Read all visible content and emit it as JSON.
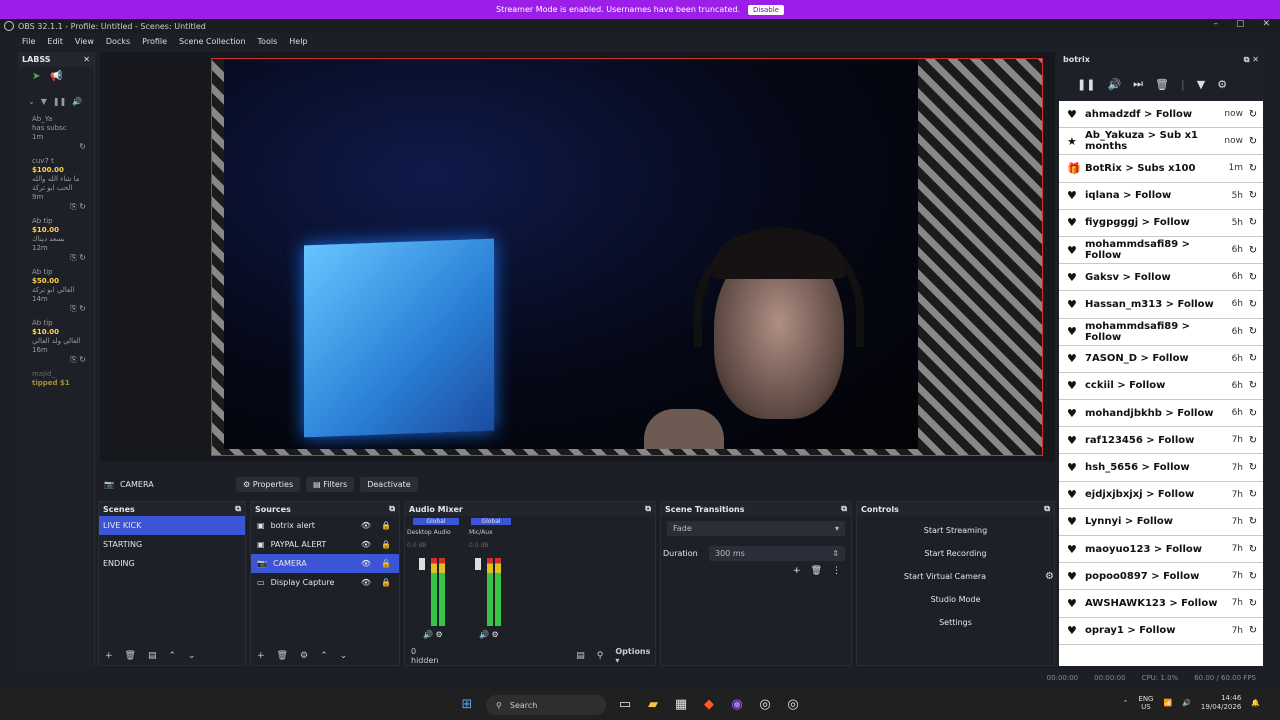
{
  "streamer_bar": {
    "message": "Streamer Mode is enabled. Usernames have been truncated.",
    "button": "Disable"
  },
  "window": {
    "title": "OBS 32.1.1 - Profile: Untitled - Scenes: Untitled"
  },
  "menu": [
    "File",
    "Edit",
    "View",
    "Docks",
    "Profile",
    "Scene Collection",
    "Tools",
    "Help"
  ],
  "labss": {
    "title": "LABSS",
    "items": [
      {
        "name": "Ab_Ya",
        "text": "has subsc",
        "time": "1m"
      },
      {
        "name": "cuv7 t",
        "amount": "$100.00",
        "text": "ما شاء الله والله الحب ابو تركة",
        "time": "9m"
      },
      {
        "name": "Ab tip",
        "amount": "$10.00",
        "text": "يسعد ديناك",
        "time": "12m"
      },
      {
        "name": "Ab tip",
        "amount": "$50.00",
        "text": "الغالي ابو تركة",
        "time": "14m"
      },
      {
        "name": "Ab tip",
        "amount": "$10.00",
        "text": "الغالي ولد الغالي",
        "time": "16m"
      },
      {
        "name": "majid_",
        "amount": "tipped $1",
        "text": ""
      }
    ]
  },
  "toolbar": {
    "scene_name": "CAMERA",
    "properties": "Properties",
    "filters": "Filters",
    "deactivate": "Deactivate"
  },
  "scenes": {
    "title": "Scenes",
    "items": [
      "LIVE KICK",
      "STARTING",
      "ENDING"
    ]
  },
  "sources": {
    "title": "Sources",
    "items": [
      "botrix alert",
      "PAYPAL ALERT",
      "CAMERA",
      "Display Capture"
    ]
  },
  "audio": {
    "title": "Audio Mixer",
    "ch1": {
      "badge": "Global",
      "name": "Desktop Audio",
      "db": "0.0 dB"
    },
    "ch2": {
      "badge": "Global",
      "name": "Mic/Aux",
      "db": "0.0 dB"
    },
    "hidden": "0 hidden",
    "options": "Options"
  },
  "transitions": {
    "title": "Scene Transitions",
    "type": "Fade",
    "duration_label": "Duration",
    "duration": "300 ms"
  },
  "controls": {
    "title": "Controls",
    "buttons": [
      "Start Streaming",
      "Start Recording",
      "Start Virtual Camera",
      "Studio Mode",
      "Settings"
    ]
  },
  "botrix": {
    "title": "botrix",
    "events": [
      {
        "icon": "heart",
        "text": "ahmadzdf > Follow",
        "time": "now"
      },
      {
        "icon": "star",
        "text": "Ab_Yakuza > Sub x1 months",
        "time": "now"
      },
      {
        "icon": "gift",
        "text": "BotRix > Subs x100",
        "time": "1m"
      },
      {
        "icon": "heart",
        "text": "iqlana > Follow",
        "time": "5h"
      },
      {
        "icon": "heart",
        "text": "fiygpgggj > Follow",
        "time": "5h"
      },
      {
        "icon": "heart",
        "text": "mohammdsafi89 > Follow",
        "time": "6h"
      },
      {
        "icon": "heart",
        "text": "Gaksv > Follow",
        "time": "6h"
      },
      {
        "icon": "heart",
        "text": "Hassan_m313 > Follow",
        "time": "6h"
      },
      {
        "icon": "heart",
        "text": "mohammdsafi89 > Follow",
        "time": "6h"
      },
      {
        "icon": "heart",
        "text": "7ASON_D > Follow",
        "time": "6h"
      },
      {
        "icon": "heart",
        "text": "cckiil > Follow",
        "time": "6h"
      },
      {
        "icon": "heart",
        "text": "mohandjbkhb > Follow",
        "time": "6h"
      },
      {
        "icon": "heart",
        "text": "raf123456 > Follow",
        "time": "7h"
      },
      {
        "icon": "heart",
        "text": "hsh_5656 > Follow",
        "time": "7h"
      },
      {
        "icon": "heart",
        "text": "ejdjxjbxjxj > Follow",
        "time": "7h"
      },
      {
        "icon": "heart",
        "text": "Lynnyi > Follow",
        "time": "7h"
      },
      {
        "icon": "heart",
        "text": "maoyuo123 > Follow",
        "time": "7h"
      },
      {
        "icon": "heart",
        "text": "popoo0897 > Follow",
        "time": "7h"
      },
      {
        "icon": "heart",
        "text": "AWSHAWK123 > Follow",
        "time": "7h"
      },
      {
        "icon": "heart",
        "text": "opray1 > Follow",
        "time": "7h"
      }
    ]
  },
  "status": {
    "cpu": "CPU: 1.0%",
    "fps": "60.00 / 60.00 FPS",
    "stream_time": "00:00:00",
    "rec_time": "00:00:00"
  },
  "taskbar": {
    "search": "Search",
    "lang1": "ENG",
    "lang2": "US",
    "time": "14:46",
    "date": "19/04/2026"
  },
  "colors": {
    "accent": "#3b55d6",
    "streamer": "#9b1fe8",
    "record_border": "#d32f2f"
  }
}
